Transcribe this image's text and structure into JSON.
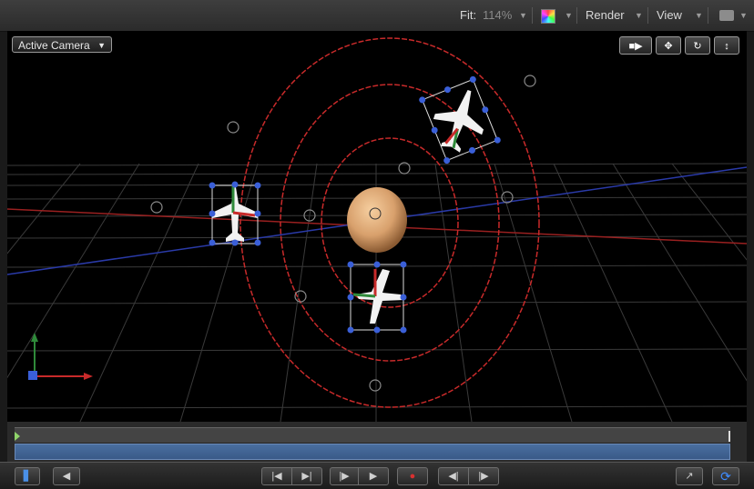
{
  "toolbar": {
    "fit_label": "Fit:",
    "fit_value": "114%",
    "render_label": "Render",
    "view_label": "View"
  },
  "canvas": {
    "camera_select": "Active Camera"
  },
  "icons": {
    "camera": "camera-icon",
    "orbit": "orbit-icon",
    "rotate": "rotate-icon",
    "dolly": "dolly-icon",
    "play": "play-icon",
    "record": "record-icon",
    "loop": "loop-icon",
    "fullscreen": "fullscreen-icon"
  },
  "colors": {
    "guide_red": "#c82a2a",
    "handle_blue": "#3a5fd8",
    "planet": "#e0aa76",
    "loop_active": "#3f8cff"
  }
}
